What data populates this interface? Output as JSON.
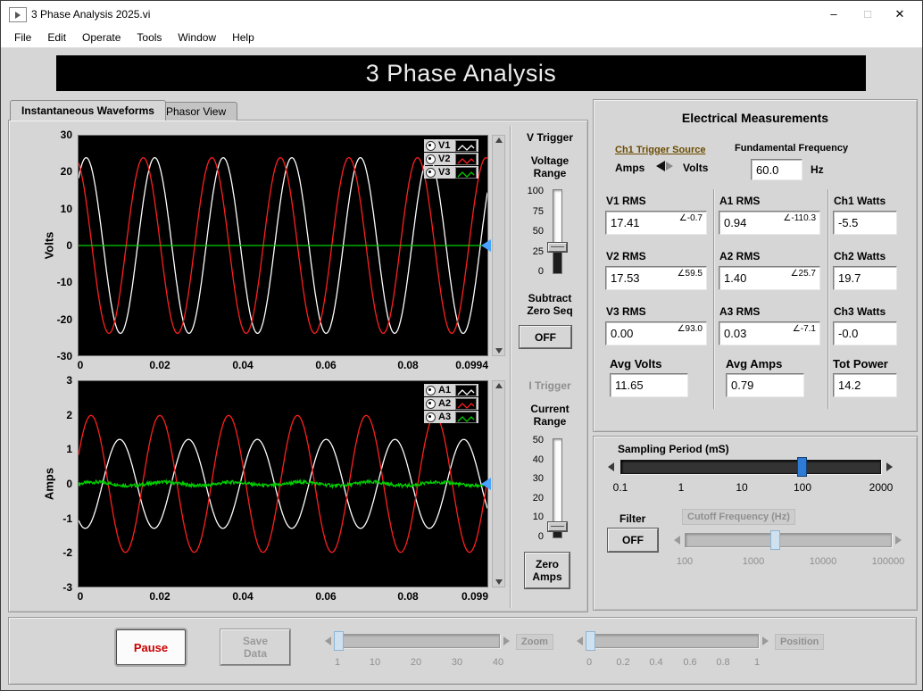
{
  "window": {
    "title": "3 Phase Analysis 2025.vi",
    "controls": {
      "minimize": "–",
      "maximize": "□",
      "close": "✕"
    }
  },
  "menu": {
    "items": [
      "File",
      "Edit",
      "Operate",
      "Tools",
      "Window",
      "Help"
    ]
  },
  "banner": {
    "title": "3 Phase Analysis"
  },
  "tabs": [
    {
      "label": "Instantaneous Waveforms"
    },
    {
      "label": "Phasor View"
    }
  ],
  "v_trigger": {
    "title": "V Trigger",
    "range_label": "Voltage\nRange",
    "scale": [
      "100",
      "75",
      "50",
      "25",
      "0"
    ],
    "value": 30,
    "subtract_label": "Subtract\nZero Seq",
    "subtract_button": "OFF"
  },
  "i_trigger": {
    "title": "I Trigger",
    "range_label": "Current\nRange",
    "scale": [
      "50",
      "40",
      "30",
      "20",
      "10",
      "0"
    ],
    "value": 5,
    "zero_button": "Zero\nAmps"
  },
  "measurements": {
    "title": "Electrical Measurements",
    "trigger_source": {
      "label": "Ch1 Trigger Source",
      "left": "Amps",
      "right": "Volts"
    },
    "fundamental_frequency": {
      "label": "Fundamental Frequency",
      "value": "60.0",
      "unit": "Hz"
    },
    "rms": [
      {
        "label": "V1 RMS",
        "value": "17.41",
        "angle": "∠-0.7"
      },
      {
        "label": "V2 RMS",
        "value": "17.53",
        "angle": "∠59.5"
      },
      {
        "label": "V3 RMS",
        "value": "0.00",
        "angle": "∠93.0"
      },
      {
        "label": "A1 RMS",
        "value": "0.94",
        "angle": "∠-110.3"
      },
      {
        "label": "A2 RMS",
        "value": "1.40",
        "angle": "∠25.7"
      },
      {
        "label": "A3 RMS",
        "value": "0.03",
        "angle": "∠-7.1"
      }
    ],
    "watts": [
      {
        "label": "Ch1 Watts",
        "value": "-5.5"
      },
      {
        "label": "Ch2 Watts",
        "value": "19.7"
      },
      {
        "label": "Ch3 Watts",
        "value": "-0.0"
      }
    ],
    "avg_volts": {
      "label": "Avg Volts",
      "value": "11.65"
    },
    "avg_amps": {
      "label": "Avg Amps",
      "value": "0.79"
    },
    "tot_power": {
      "label": "Tot Power",
      "value": "14.2"
    }
  },
  "sampling": {
    "label": "Sampling Period (mS)",
    "scale": [
      "0.1",
      "1",
      "10",
      "100",
      "2000"
    ],
    "value": "100"
  },
  "filter": {
    "label": "Filter",
    "button": "OFF",
    "cutoff_label": "Cutoff Frequency (Hz)",
    "cutoff_scale": [
      "100",
      "1000",
      "10000",
      "100000"
    ]
  },
  "bottom": {
    "pause": "Pause",
    "save": "Save\nData",
    "zoom_label": "Zoom",
    "zoom_scale": [
      "1",
      "10",
      "20",
      "30",
      "40"
    ],
    "position_label": "Position",
    "position_scale": [
      "0",
      "0.2",
      "0.4",
      "0.6",
      "0.8",
      "1"
    ]
  },
  "chart_data": [
    {
      "type": "line",
      "ylabel": "Volts",
      "xlim": [
        0,
        0.0994
      ],
      "ylim": [
        -30,
        30
      ],
      "x_ticks": [
        "0",
        "0.02",
        "0.04",
        "0.06",
        "0.08",
        "0.0994"
      ],
      "y_ticks": [
        "30",
        "20",
        "10",
        "0",
        "-10",
        "-20",
        "-30"
      ],
      "grid": false,
      "legend_position": "top-right",
      "trigger_level": 0,
      "series": [
        {
          "name": "V1",
          "color": "#ffffff",
          "waveform": "sine",
          "amplitude": 24,
          "frequency_hz": 60,
          "phase_deg": 50
        },
        {
          "name": "V2",
          "color": "#ff1f1f",
          "waveform": "sine",
          "amplitude": 24,
          "frequency_hz": 60,
          "phase_deg": 110
        },
        {
          "name": "V3",
          "color": "#00d000",
          "waveform": "sine",
          "amplitude": 0,
          "frequency_hz": 60,
          "phase_deg": 0
        }
      ]
    },
    {
      "type": "line",
      "ylabel": "Amps",
      "xlim": [
        0,
        0.099
      ],
      "ylim": [
        -3,
        3
      ],
      "x_ticks": [
        "0",
        "0.02",
        "0.04",
        "0.06",
        "0.08",
        "0.099"
      ],
      "y_ticks": [
        "3",
        "2",
        "1",
        "0",
        "-1",
        "-2",
        "-3"
      ],
      "grid": false,
      "legend_position": "top-right",
      "trigger_level": 0,
      "series": [
        {
          "name": "A1",
          "color": "#ffffff",
          "waveform": "sine",
          "amplitude": 1.3,
          "frequency_hz": 60,
          "phase_deg": 235
        },
        {
          "name": "A2",
          "color": "#ff1f1f",
          "waveform": "sine",
          "amplitude": 2.0,
          "frequency_hz": 60,
          "phase_deg": 25
        },
        {
          "name": "A3",
          "color": "#00d000",
          "waveform": "sine",
          "amplitude": 0.05,
          "frequency_hz": 60,
          "phase_deg": 0,
          "noise": 0.05
        }
      ]
    }
  ]
}
